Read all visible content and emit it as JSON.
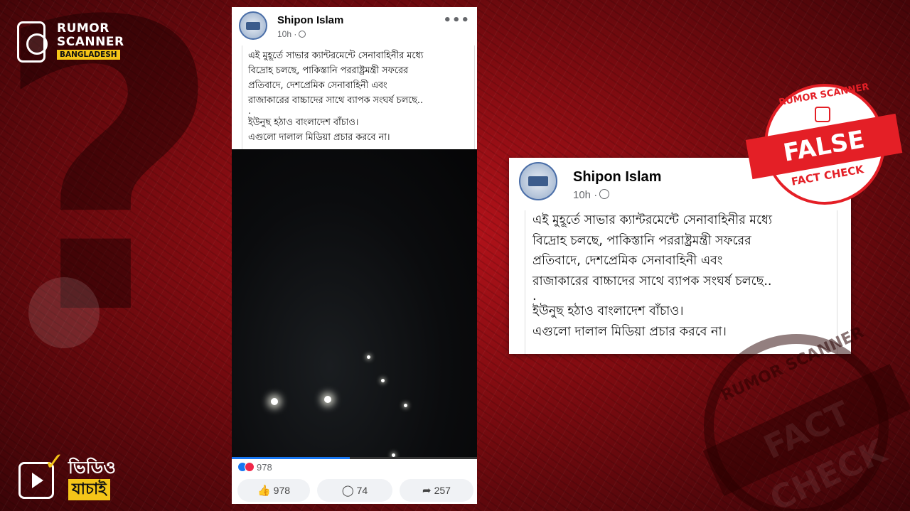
{
  "brand": {
    "line1": "RUMOR",
    "line2": "SCANNER",
    "sub": "BANGLADESH"
  },
  "video_badge": {
    "line1": "ভিডিও",
    "line2": "যাচাই"
  },
  "post": {
    "author": "Shipon Islam",
    "time": "10h ·",
    "more": "•••",
    "text_lines": [
      "এই মুহূর্তে সাভার ক্যান্টরমেন্টে সেনাবাহিনীর মধ্যে",
      "বিদ্রোহ চলছে, পাকিস্তানি পররাষ্ট্রমন্ত্রী সফরের",
      "প্রতিবাদে, দেশপ্রেমিক সেনাবাহিনী এবং",
      "রাজাকারের বাচ্চাদের সাথে ব্যাপক সংঘর্ষ চলছে..",
      ".",
      "ইউনুছ হঠাও বাংলাদেশ বাঁচাও।",
      "এগুলো দালাল মিডিয়া প্রচার করবে না।"
    ],
    "video_progress": 0.48,
    "reaction_count": "978",
    "like_count": "978",
    "comment_count": "74",
    "share_count": "257"
  },
  "zoom": {
    "author": "Shipon Islam",
    "time": "10h ·"
  },
  "stamp": {
    "top": "RUMOR SCANNER",
    "main": "FALSE",
    "bottom": "FACT CHECK"
  },
  "watermark": {
    "top": "RUMOR SCANNER",
    "band": "FACT CHECK"
  },
  "colors": {
    "accent_red": "#e41f26",
    "brand_yellow": "#f5c518",
    "fb_blue": "#1877f2"
  }
}
